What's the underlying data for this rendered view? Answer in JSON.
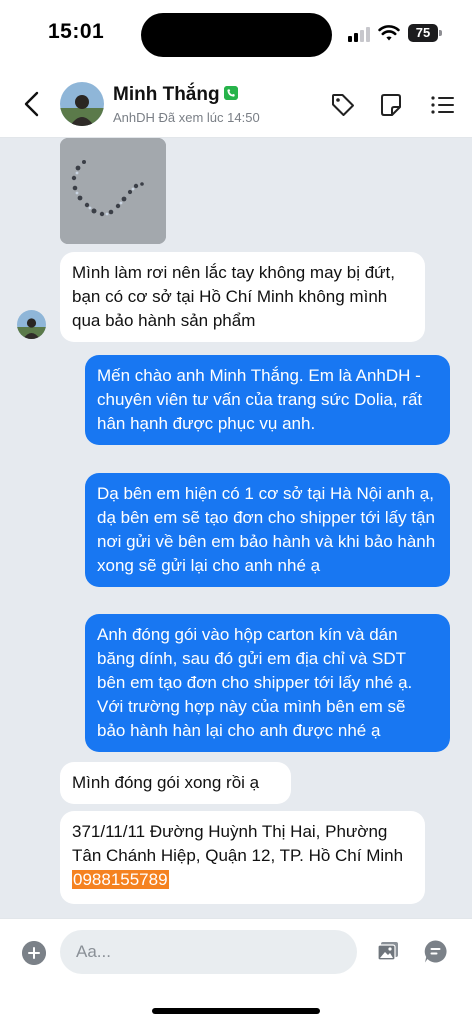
{
  "status_bar": {
    "time": "15:01",
    "battery": "75"
  },
  "header": {
    "contact_name": "Minh Thắng",
    "status": "AnhDH Đã xem lúc 14:50"
  },
  "messages": [
    {
      "type": "image",
      "direction": "in"
    },
    {
      "type": "text",
      "direction": "in",
      "text": "Mình làm rơi nên lắc tay không may bị đứt, bạn có cơ sở tại Hồ Chí Minh không mình qua bảo hành sản phẩm"
    },
    {
      "type": "text",
      "direction": "out",
      "text": "Mến chào anh Minh Thắng. Em là AnhDH - chuyên viên tư vấn của trang sức Dolia, rất hân hạnh được phục vụ anh."
    },
    {
      "type": "text",
      "direction": "out",
      "text": "Dạ bên em hiện có 1 cơ sở tại Hà Nội anh ạ, dạ bên em sẽ tạo đơn cho shipper tới lấy tận nơi gửi về bên em bảo hành và khi bảo hành xong sẽ gửi lại cho anh nhé ạ"
    },
    {
      "type": "text",
      "direction": "out",
      "text": "Anh đóng gói vào hộp carton kín và dán băng dính, sau đó gửi em địa chỉ và SDT bên em tạo đơn cho shipper tới lấy nhé ạ. Với trường hợp này của mình bên em sẽ bảo hành hàn lại cho anh được nhé ạ"
    },
    {
      "type": "text",
      "direction": "in",
      "text": "Mình đóng gói xong rồi ạ"
    },
    {
      "type": "text",
      "direction": "in",
      "text": "371/11/11 Đường Huỳnh Thị Hai, Phường Tân Chánh Hiệp, Quận 12, TP. Hồ Chí Minh",
      "phone": "0988155789"
    }
  ],
  "input": {
    "placeholder": "Aa..."
  },
  "colors": {
    "outgoing_bubble": "#1877f2",
    "incoming_bubble": "#ffffff",
    "chat_background": "#e6eaef",
    "phone_highlight": "#f58220",
    "verified_badge": "#27b34a"
  },
  "icons": {
    "back": "chevron-left-icon",
    "tag": "tag-icon",
    "note": "note-icon",
    "menu": "menu-icon",
    "plus": "plus-icon",
    "gallery": "gallery-icon",
    "sticker": "sticker-icon"
  }
}
